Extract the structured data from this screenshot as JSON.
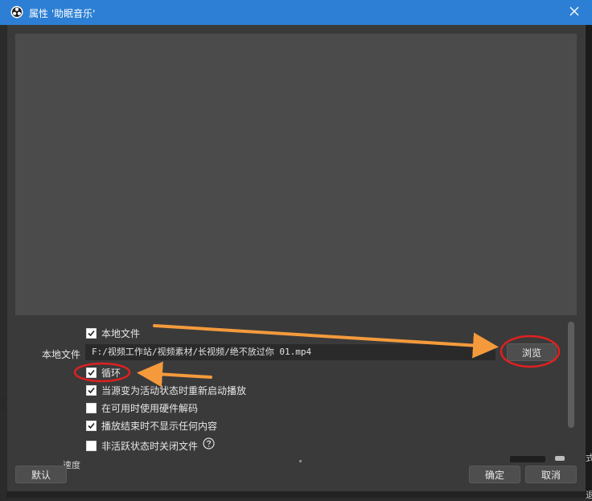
{
  "window": {
    "title": "属性 '助眠音乐'"
  },
  "source": {
    "local_file_checkbox": {
      "label": "本地文件",
      "checked": true
    },
    "local_file_label": "本地文件",
    "path_value": "F:/视频工作站/视频素材/长视频/绝不放过你 01.mp4",
    "browse_label": "浏览",
    "options": [
      {
        "label": "循环",
        "checked": true
      },
      {
        "label": "当源变为活动状态时重新启动播放",
        "checked": true
      },
      {
        "label": "在可用时使用硬件解码",
        "checked": false
      },
      {
        "label": "播放结束时不显示任何内容",
        "checked": true
      },
      {
        "label": "非活跃状态时关闭文件",
        "checked": false
      }
    ]
  },
  "footer": {
    "defaults_label": "默认",
    "ok_label": "确定",
    "cancel_label": "取消"
  },
  "colors": {
    "titlebar": "#2c7fd4",
    "annotation_orange": "#f59a3c",
    "annotation_red": "#e02020",
    "panel": "#3a3a3a",
    "preview": "#4b4b4b"
  },
  "icons": {
    "app": "obs-logo-icon",
    "close": "close-icon",
    "help": "help-circle-icon"
  }
}
